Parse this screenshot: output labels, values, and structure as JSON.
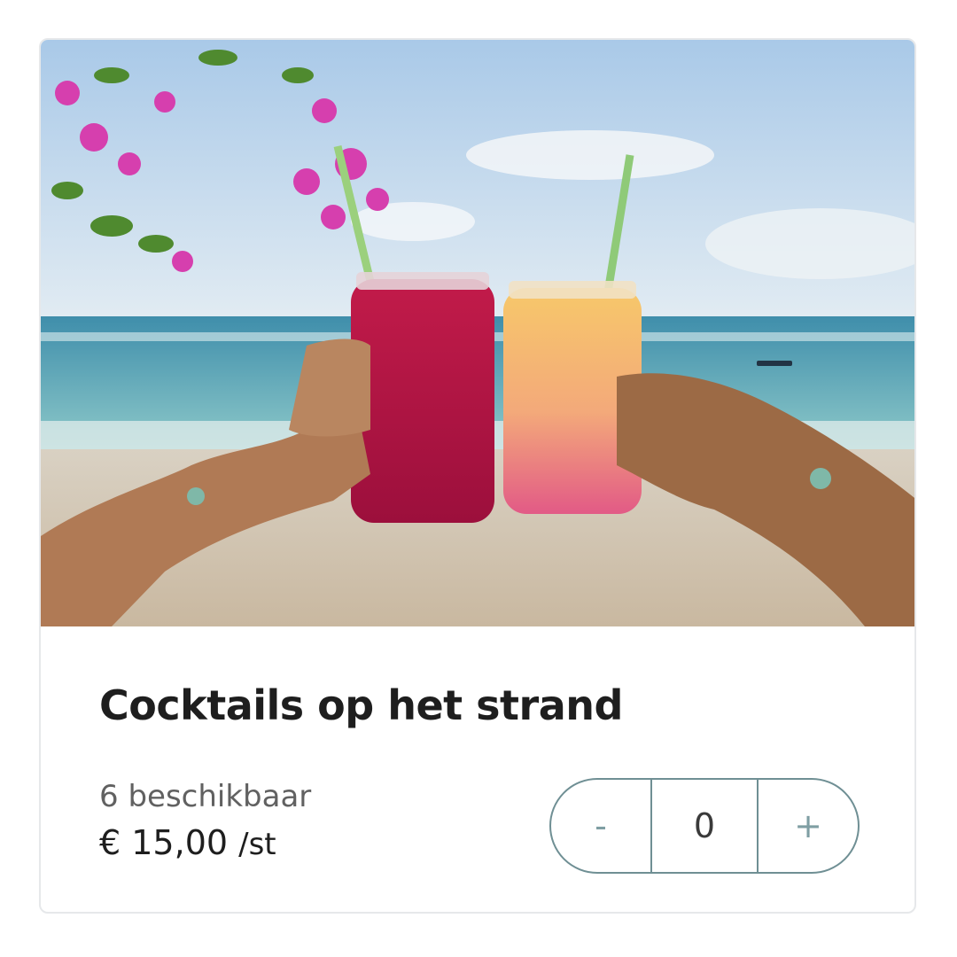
{
  "product": {
    "image_alt": "Twee handen proosten met cocktails in potglazen op het strand",
    "title": "Cocktails op het strand",
    "availability": "6 beschikbaar",
    "price": "€ 15,00",
    "price_unit": "/st"
  },
  "quantity": {
    "decrement_label": "-",
    "value": "0",
    "increment_label": "+"
  }
}
